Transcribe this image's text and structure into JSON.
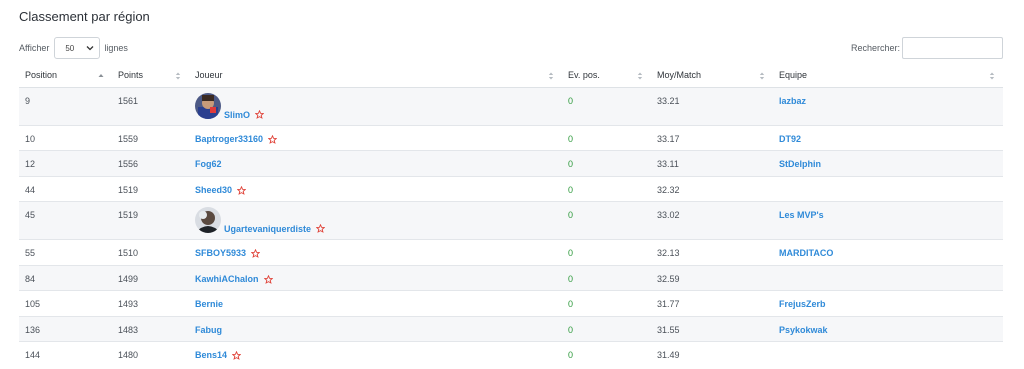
{
  "page": {
    "title": "Classement par région"
  },
  "controls": {
    "show_label": "Afficher",
    "page_size": "50",
    "rows_label": "lignes",
    "search_label": "Rechercher:",
    "search_value": ""
  },
  "table": {
    "columns": [
      "Position",
      "Points",
      "Joueur",
      "Ev. pos.",
      "Moy/Match",
      "Equipe"
    ],
    "rows": [
      {
        "position": "9",
        "points": "1561",
        "player": "SlimO",
        "starred": true,
        "avatar": true,
        "ev": "0",
        "avg": "33.21",
        "team": "lazbaz"
      },
      {
        "position": "10",
        "points": "1559",
        "player": "Baptroger33160",
        "starred": true,
        "avatar": false,
        "ev": "0",
        "avg": "33.17",
        "team": "DT92"
      },
      {
        "position": "12",
        "points": "1556",
        "player": "Fog62",
        "starred": false,
        "avatar": false,
        "ev": "0",
        "avg": "33.11",
        "team": "StDelphin"
      },
      {
        "position": "44",
        "points": "1519",
        "player": "Sheed30",
        "starred": true,
        "avatar": false,
        "ev": "0",
        "avg": "32.32",
        "team": ""
      },
      {
        "position": "45",
        "points": "1519",
        "player": "Ugartevaniquerdiste",
        "starred": true,
        "avatar": true,
        "ev": "0",
        "avg": "33.02",
        "team": "Les MVP's"
      },
      {
        "position": "55",
        "points": "1510",
        "player": "SFBOY5933",
        "starred": true,
        "avatar": false,
        "ev": "0",
        "avg": "32.13",
        "team": "MARDITACO"
      },
      {
        "position": "84",
        "points": "1499",
        "player": "KawhiAChalon",
        "starred": true,
        "avatar": false,
        "ev": "0",
        "avg": "32.59",
        "team": ""
      },
      {
        "position": "105",
        "points": "1493",
        "player": "Bernie",
        "starred": false,
        "avatar": false,
        "ev": "0",
        "avg": "31.77",
        "team": "FrejusZerb"
      },
      {
        "position": "136",
        "points": "1483",
        "player": "Fabug",
        "starred": false,
        "avatar": false,
        "ev": "0",
        "avg": "31.55",
        "team": "Psykokwak"
      },
      {
        "position": "144",
        "points": "1480",
        "player": "Bens14",
        "starred": true,
        "avatar": false,
        "ev": "0",
        "avg": "31.49",
        "team": ""
      }
    ]
  },
  "colors": {
    "link": "#2f8ad8",
    "positive": "#2e9a3c",
    "star": "#e0443a",
    "stripe": "#f6f7f9"
  },
  "icons": {
    "sort": "sort-arrows-icon",
    "star": "star-outline-icon",
    "select": "chevron-down-icon"
  }
}
